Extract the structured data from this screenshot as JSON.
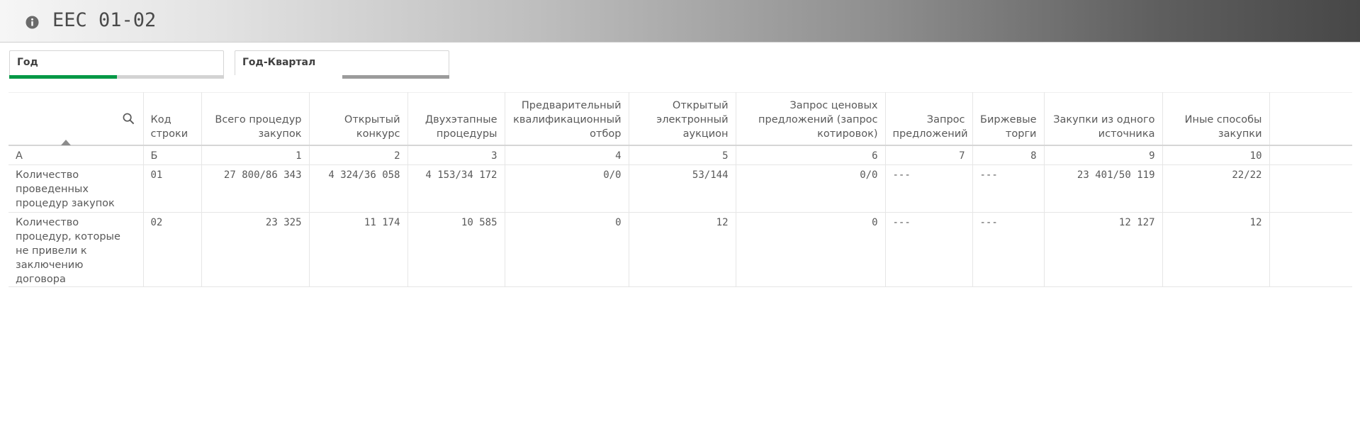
{
  "header": {
    "title": "EEC 01-02",
    "info_icon": "info-icon"
  },
  "filters": [
    {
      "label": "Год",
      "bar": [
        [
          "#009845",
          0.5
        ],
        [
          "#d3d3d3",
          0.5
        ]
      ]
    },
    {
      "label": "Год-Квартал",
      "bar": [
        [
          "#ffffff",
          0.5
        ],
        [
          "#9b9b9b",
          0.5
        ]
      ]
    }
  ],
  "table": {
    "columns": [
      "",
      "Код строки",
      "Всего процедур закупок",
      "Открытый конкурс",
      "Двухэтапные процедуры",
      "Предварительный квалификационный отбор",
      "Открытый электронный аукцион",
      "Запрос ценовых предложений (запрос котировок)",
      "Запрос предложений",
      "Биржевые торги",
      "Закупки из одного источника",
      "Иные способы закупки"
    ],
    "index_row": [
      "А",
      "Б",
      "1",
      "2",
      "3",
      "4",
      "5",
      "6",
      "7",
      "8",
      "9",
      "10"
    ],
    "rows": [
      [
        "Количество проведенных процедур закупок",
        "01",
        "27 800/86 343",
        "4 324/36 058",
        "4 153/34 172",
        "0/0",
        "53/144",
        "0/0",
        "---",
        "---",
        "23 401/50 119",
        "22/22"
      ],
      [
        "Количество процедур, которые не привели к заключению договора",
        "02",
        "23 325",
        "11 174",
        "10 585",
        "0",
        "12",
        "0",
        "---",
        "---",
        "12 127",
        "12"
      ]
    ]
  }
}
